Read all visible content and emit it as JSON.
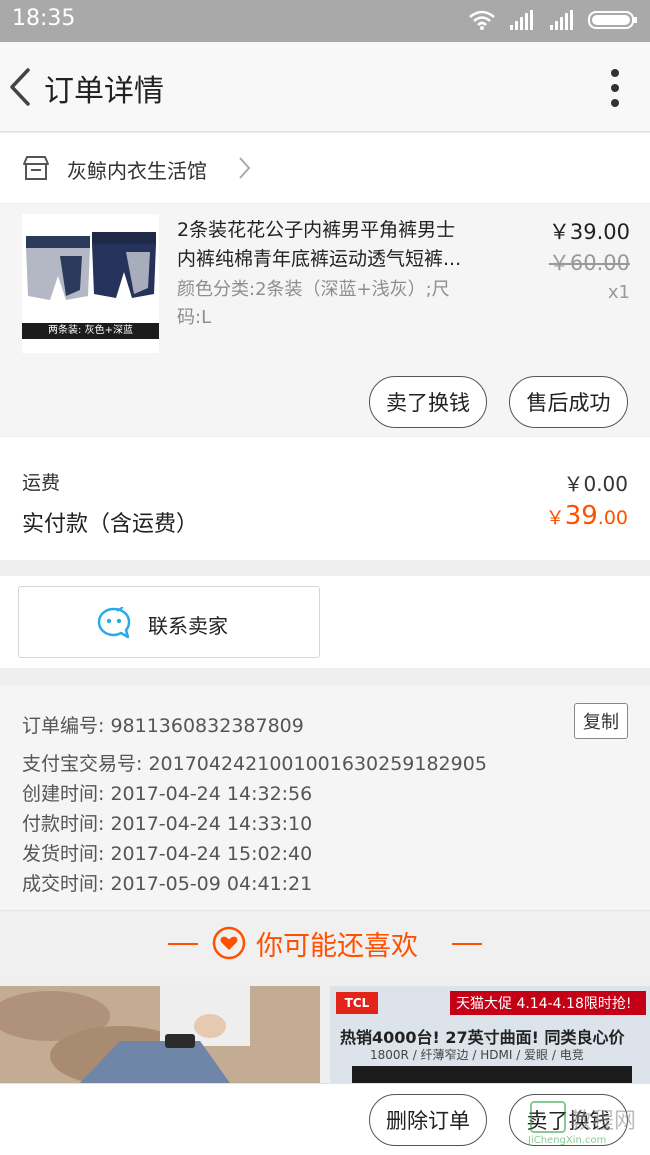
{
  "status_bar": {
    "time": "18:35"
  },
  "header": {
    "title": "订单详情"
  },
  "shop": {
    "name": "灰鲸内衣生活馆"
  },
  "product": {
    "name_line1": "2条装花花公子内裤男平角裤男士",
    "name_line2": "内裤纯棉青年底裤运动透气短裤...",
    "sku_line1": "颜色分类:2条装（深蓝+浅灰）;尺",
    "sku_line2": "码:L",
    "image_caption": "两条装: 灰色+深蓝",
    "price": "￥39.00",
    "original_price": "￥60.00",
    "quantity": "x1",
    "actions": [
      "卖了换钱",
      "售后成功"
    ]
  },
  "fees": {
    "shipping_label": "运费",
    "shipping_value": "￥0.00",
    "paid_label": "实付款（含运费）",
    "paid_currency": "￥",
    "paid_int": "39",
    "paid_dec": ".00"
  },
  "contact": {
    "label": "联系卖家"
  },
  "order_info": {
    "order_no": "订单编号: 9811360832387809",
    "copy_label": "复制",
    "alipay_no": "支付宝交易号: 2017042421001001630259182905",
    "created": "创建时间: 2017-04-24 14:32:56",
    "paid": "付款时间: 2017-04-24 14:33:10",
    "shipped": "发货时间: 2017-04-24 15:02:40",
    "completed": "成交时间: 2017-05-09 04:41:21"
  },
  "recommend": {
    "title": "你可能还喜欢"
  },
  "banner_right": {
    "logo": "TCL",
    "promo": "天猫大促 4.14-4.18限时抢!",
    "headline": "热销4000台! 27英寸曲面! 同类良心价",
    "sub": "1800R / 纤薄窄边 / HDMI / 爱眼 / 电竞"
  },
  "bottom_actions": [
    "删除订单",
    "卖了换钱"
  ],
  "watermark": {
    "text": "教程网",
    "url": "JiChengXin.com"
  },
  "colors": {
    "accent": "#ff5000",
    "chat_icon": "#29a9ec"
  }
}
